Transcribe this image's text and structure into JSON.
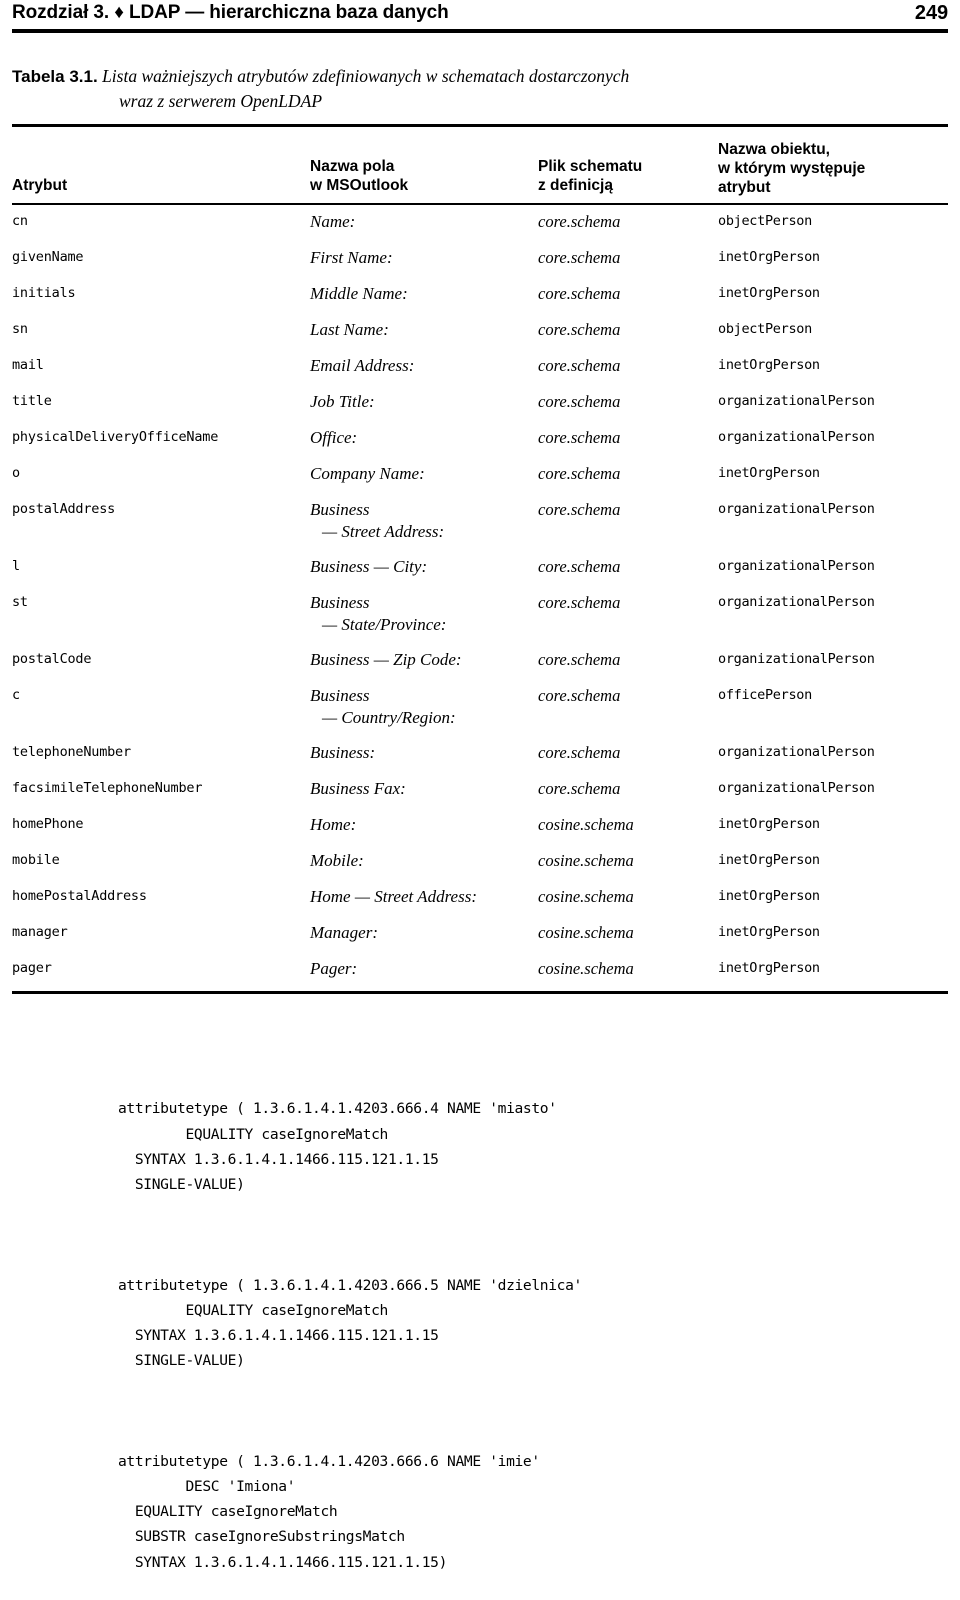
{
  "page": {
    "running_head": "Rozdział 3.  ♦  LDAP — hierarchiczna baza danych",
    "folio": "249"
  },
  "caption": {
    "label": "Tabela 3.1.",
    "line1": "Lista ważniejszych atrybutów zdefiniowanych w schematach dostarczonych",
    "line2": "wraz z serwerem OpenLDAP"
  },
  "table": {
    "headers": [
      "Atrybut",
      "Nazwa pola\nw MSOutlook",
      "Plik schematu\nz definicją",
      "Nazwa obiektu,\nw którym występuje\natrybut"
    ],
    "headers_flat": {
      "h1": "Atrybut",
      "h2_l1": "Nazwa pola",
      "h2_l2": "w MSOutlook",
      "h3_l1": "Plik schematu",
      "h3_l2": "z definicją",
      "h4_l1": "Nazwa obiektu,",
      "h4_l2": "w którym występuje",
      "h4_l3": "atrybut"
    },
    "rows": [
      {
        "attribute": "cn",
        "field": "Name:",
        "field_cont": "",
        "schema": "core.schema",
        "object": "objectPerson"
      },
      {
        "attribute": "givenName",
        "field": "First Name:",
        "field_cont": "",
        "schema": "core.schema",
        "object": "inetOrgPerson"
      },
      {
        "attribute": "initials",
        "field": "Middle Name:",
        "field_cont": "",
        "schema": "core.schema",
        "object": "inetOrgPerson"
      },
      {
        "attribute": "sn",
        "field": "Last Name:",
        "field_cont": "",
        "schema": "core.schema",
        "object": "objectPerson"
      },
      {
        "attribute": "mail",
        "field": "Email Address:",
        "field_cont": "",
        "schema": "core.schema",
        "object": "inetOrgPerson"
      },
      {
        "attribute": "title",
        "field": "Job Title:",
        "field_cont": "",
        "schema": "core.schema",
        "object": "organizationalPerson"
      },
      {
        "attribute": "physicalDeliveryOfficeName",
        "field": "Office:",
        "field_cont": "",
        "schema": "core.schema",
        "object": "organizationalPerson"
      },
      {
        "attribute": "o",
        "field": "Company Name:",
        "field_cont": "",
        "schema": "core.schema",
        "object": "inetOrgPerson"
      },
      {
        "attribute": "postalAddress",
        "field": "Business",
        "field_cont": "— Street Address:",
        "schema": "core.schema",
        "object": "organizationalPerson"
      },
      {
        "attribute": "l",
        "field": "Business — City:",
        "field_cont": "",
        "schema": "core.schema",
        "object": "organizationalPerson"
      },
      {
        "attribute": "st",
        "field": "Business",
        "field_cont": "— State/Province:",
        "schema": "core.schema",
        "object": "organizationalPerson"
      },
      {
        "attribute": "postalCode",
        "field": "Business — Zip Code:",
        "field_cont": "",
        "schema": "core.schema",
        "object": "organizationalPerson"
      },
      {
        "attribute": "c",
        "field": "Business",
        "field_cont": "— Country/Region:",
        "schema": "core.schema",
        "object": "officePerson"
      },
      {
        "attribute": "telephoneNumber",
        "field": "Business:",
        "field_cont": "",
        "schema": "core.schema",
        "object": "organizationalPerson"
      },
      {
        "attribute": "facsimileTelephoneNumber",
        "field": "Business Fax:",
        "field_cont": "",
        "schema": "core.schema",
        "object": "organizationalPerson"
      },
      {
        "attribute": "homePhone",
        "field": "Home:",
        "field_cont": "",
        "schema": "cosine.schema",
        "object": "inetOrgPerson"
      },
      {
        "attribute": "mobile",
        "field": "Mobile:",
        "field_cont": "",
        "schema": "cosine.schema",
        "object": "inetOrgPerson"
      },
      {
        "attribute": "homePostalAddress",
        "field": "Home — Street Address:",
        "field_cont": "",
        "schema": "cosine.schema",
        "object": "inetOrgPerson"
      },
      {
        "attribute": "manager",
        "field": "Manager:",
        "field_cont": "",
        "schema": "cosine.schema",
        "object": "inetOrgPerson"
      },
      {
        "attribute": "pager",
        "field": "Pager:",
        "field_cont": "",
        "schema": "cosine.schema",
        "object": "inetOrgPerson"
      }
    ]
  },
  "code": {
    "block1": "attributetype ( 1.3.6.1.4.1.4203.666.4 NAME 'miasto'\n        EQUALITY caseIgnoreMatch\n  SYNTAX 1.3.6.1.4.1.1466.115.121.1.15\n  SINGLE-VALUE)",
    "block2": "attributetype ( 1.3.6.1.4.1.4203.666.5 NAME 'dzielnica'\n        EQUALITY caseIgnoreMatch\n  SYNTAX 1.3.6.1.4.1.1466.115.121.1.15\n  SINGLE-VALUE)",
    "block3": "attributetype ( 1.3.6.1.4.1.4203.666.6 NAME 'imie'\n        DESC 'Imiona'\n  EQUALITY caseIgnoreMatch\n  SUBSTR caseIgnoreSubstringsMatch\n  SYNTAX 1.3.6.1.4.1.1466.115.121.1.15)"
  }
}
